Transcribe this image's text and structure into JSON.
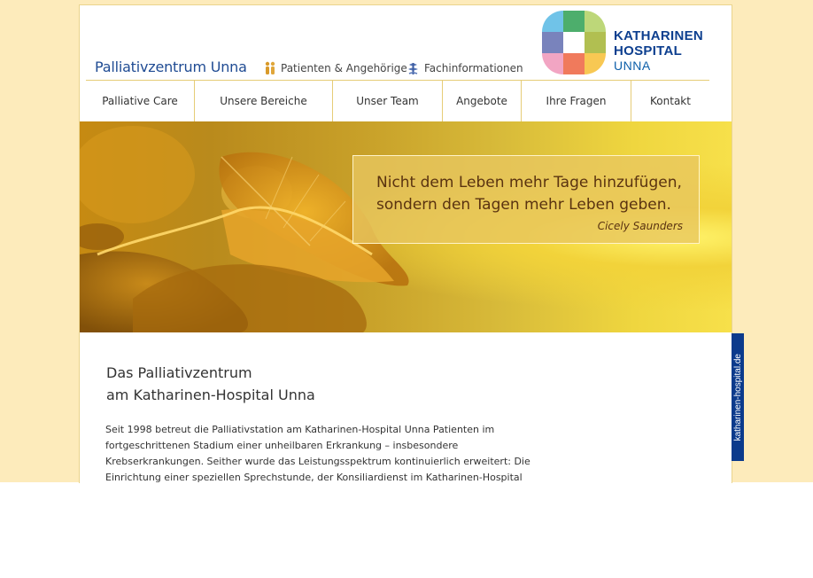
{
  "header": {
    "site_title": "Palliativzentrum Unna",
    "links": [
      {
        "label": "Patienten & Angehörige",
        "icon": "people-icon"
      },
      {
        "label": "Fachinformationen",
        "icon": "caduceus-icon"
      }
    ],
    "logo": {
      "line1": "KATHARINEN",
      "line2": "HOSPITAL",
      "line3": "UNNA"
    }
  },
  "nav": {
    "items": [
      {
        "label": "Palliative Care"
      },
      {
        "label": "Unsere Bereiche"
      },
      {
        "label": "Unser Team"
      },
      {
        "label": "Angebote"
      },
      {
        "label": "Ihre Fragen"
      },
      {
        "label": "Kontakt"
      }
    ]
  },
  "hero": {
    "quote_line1": "Nicht dem Leben mehr Tage hinzufügen,",
    "quote_line2": "sondern den Tagen mehr Leben geben.",
    "author": "Cicely Saunders"
  },
  "content": {
    "title_line1": "Das Palliativzentrum",
    "title_line2": "am Katharinen-Hospital Unna",
    "body_lines": [
      "Seit 1998 betreut die Palliativstation am Katharinen-Hospital Unna Patienten im",
      "fortgeschrittenen Stadium einer unheilbaren Erkrankung – insbesondere",
      "Krebserkrankungen. Seither wurde das Leistungsspektrum kontinuierlich erweitert: Die",
      "Einrichtung einer speziellen Sprechstunde, der Konsiliardienst im Katharinen-Hospital"
    ]
  },
  "side_tab": {
    "label": "katharinen-hospital.de"
  },
  "colors": {
    "background": "#fdebbb",
    "brand_blue": "#1f4b93",
    "logo_blue": "#0d3f8f",
    "nav_divider": "#e6cc77",
    "side_tab": "#0b3a8c",
    "quote_text": "#5a3310"
  }
}
